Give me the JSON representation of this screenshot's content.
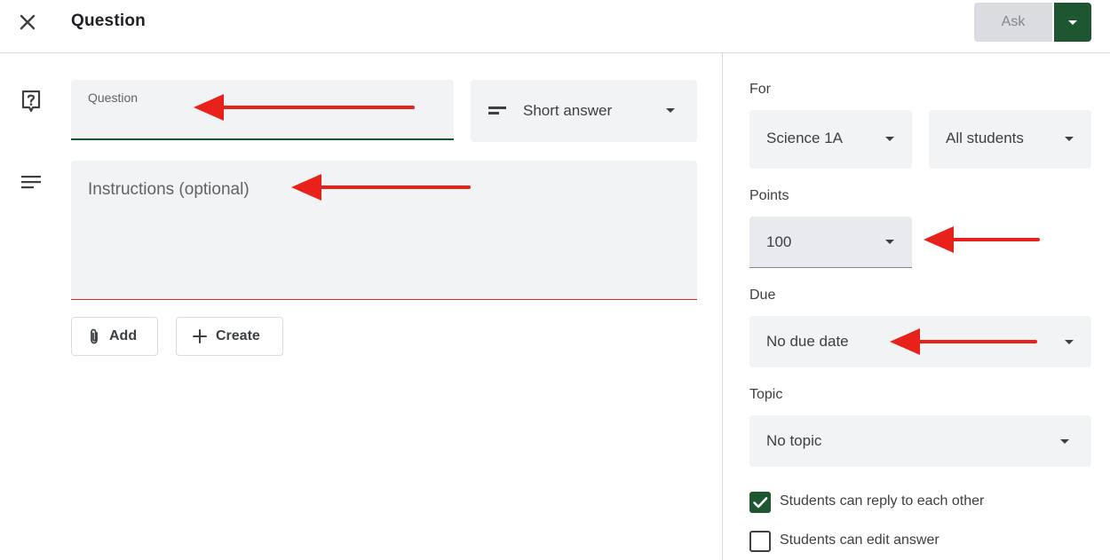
{
  "header": {
    "close_icon": "close-icon",
    "title": "Question",
    "ask_label": "Ask",
    "ask_dropdown_icon": "caret-down-icon"
  },
  "question": {
    "label": "Question",
    "icon": "question-mark-icon"
  },
  "question_type": {
    "icon": "short-answer-icon",
    "value": "Short answer"
  },
  "instructions": {
    "icon": "paragraph-icon",
    "placeholder": "Instructions (optional)"
  },
  "actions": {
    "add_label": "Add",
    "add_icon": "paperclip-icon",
    "create_label": "Create",
    "create_icon": "plus-icon"
  },
  "sidebar": {
    "for_label": "For",
    "class_value": "Science 1A",
    "students_value": "All students",
    "points_label": "Points",
    "points_value": "100",
    "due_label": "Due",
    "due_value": "No due date",
    "topic_label": "Topic",
    "topic_value": "No topic",
    "options": [
      {
        "label": "Students can reply to each other",
        "checked": true
      },
      {
        "label": "Students can edit answer",
        "checked": false
      }
    ]
  },
  "colors": {
    "accent": "#1e5631",
    "annotation_arrow": "#e8221b",
    "field_bg": "#f1f3f4"
  }
}
